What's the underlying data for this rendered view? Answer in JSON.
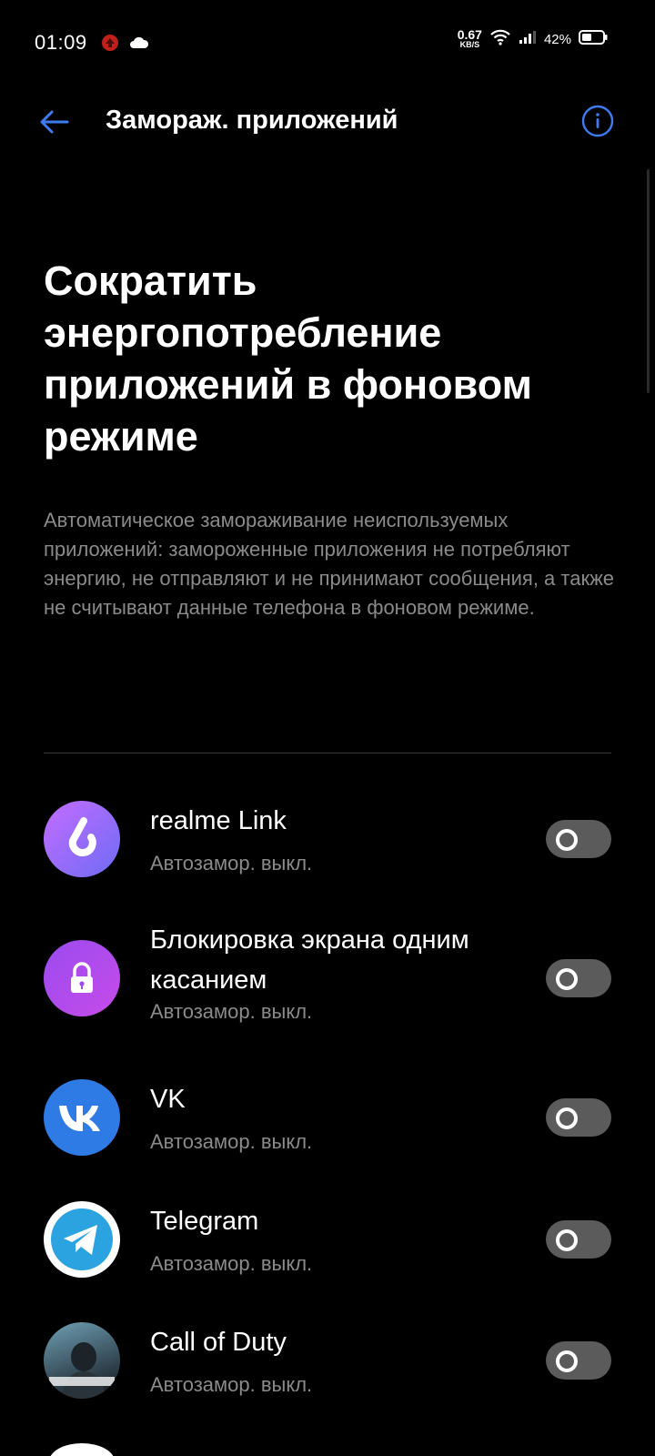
{
  "status_bar": {
    "time": "01:09",
    "net_speed_value": "0.67",
    "net_speed_unit": "KB/S",
    "battery_percent": "42%",
    "icons": [
      "game-mode-icon",
      "cloud-icon",
      "wifi-icon",
      "signal-icon",
      "battery-icon"
    ]
  },
  "header": {
    "title": "Замораж. приложений",
    "back_icon": "arrow-left-icon",
    "info_icon": "info-icon",
    "accent_color": "#3d7bf0"
  },
  "hero": {
    "title": "Сократить энергопотребление приложений в фоновом режиме",
    "description": "Автоматическое замораживание неиспользуемых приложений: замороженные приложения не потребляют энергию, не отправляют и не принимают сообщения, а также не считывают данные телефона в фоновом режиме."
  },
  "apps": [
    {
      "name": "realme Link",
      "status": "Автозамор. выкл.",
      "icon": "realme-link-icon",
      "enabled": false
    },
    {
      "name": "Блокировка экрана одним касанием",
      "status": "Автозамор. выкл.",
      "icon": "lock-screen-icon",
      "enabled": false
    },
    {
      "name": "VK",
      "status": "Автозамор. выкл.",
      "icon": "vk-icon",
      "enabled": false
    },
    {
      "name": "Telegram",
      "status": "Автозамор. выкл.",
      "icon": "telegram-icon",
      "enabled": false
    },
    {
      "name": "Call of Duty",
      "status": "Автозамор. выкл.",
      "icon": "call-of-duty-icon",
      "enabled": false
    }
  ],
  "colors": {
    "background": "#000000",
    "secondary_text": "#8a8a8a",
    "toggle_off": "#5b5b5b"
  }
}
